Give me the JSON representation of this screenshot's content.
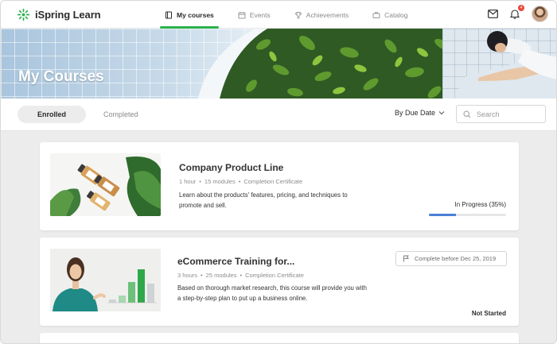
{
  "app": {
    "name": "iSpring Learn"
  },
  "nav": [
    {
      "label": "My courses",
      "icon": "book-icon",
      "active": true
    },
    {
      "label": "Events",
      "icon": "calendar-icon",
      "active": false
    },
    {
      "label": "Achievements",
      "icon": "trophy-icon",
      "active": false
    },
    {
      "label": "Catalog",
      "icon": "briefcase-icon",
      "active": false
    }
  ],
  "header": {
    "notifications_count": "4"
  },
  "banner": {
    "title": "My Courses"
  },
  "filters": {
    "tabs": [
      {
        "label": "Enrolled",
        "active": true
      },
      {
        "label": "Completed",
        "active": false
      }
    ],
    "sort_label": "By Due Date",
    "search_placeholder": "Search",
    "search_value": ""
  },
  "courses": [
    {
      "title": "Company Product Line",
      "duration": "1 hour",
      "modules": "15 modules",
      "certificate": "Completion Certificate",
      "description": "Learn about the products' features, pricing, and techniques to promote and sell.",
      "status": "In Progress (35%)",
      "progress": 0.35
    },
    {
      "title": "eCommerce Training for...",
      "duration": "3 hours",
      "modules": "25 modules",
      "certificate": "Completion Certificate",
      "description": "Based on thorough market research, this course will provide you with a step-by-step plan to put up a business online.",
      "status": "Not Started",
      "due": "Complete before Dec 25, 2019"
    }
  ],
  "colors": {
    "accent": "#2bb24c",
    "progress": "#4a7fd6",
    "badge": "#e8483b"
  }
}
